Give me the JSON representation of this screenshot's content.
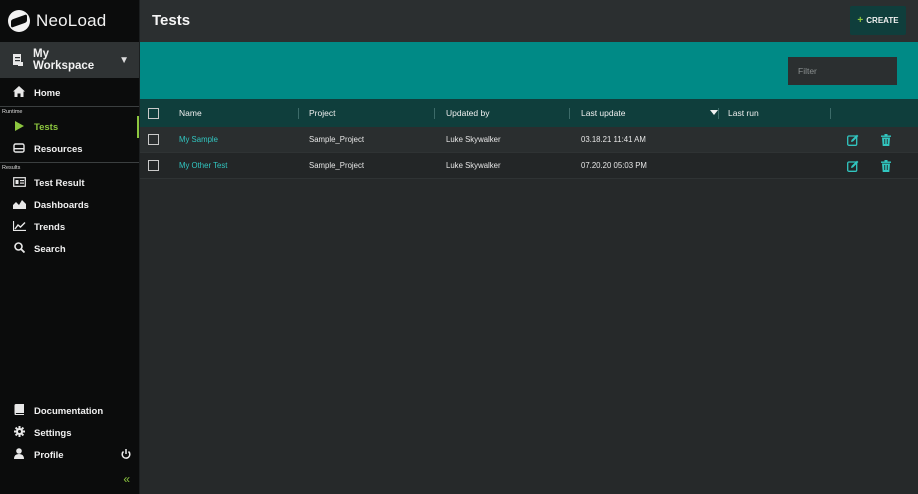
{
  "app": {
    "name": "NeoLoad"
  },
  "sidebar": {
    "workspace_label": "My Workspace",
    "home_label": "Home",
    "section_runtime": "Runtime",
    "runtime_items": [
      {
        "label": "Tests",
        "icon": "play-icon"
      },
      {
        "label": "Resources",
        "icon": "resources-icon"
      }
    ],
    "section_results": "Results",
    "results_items": [
      {
        "label": "Test Result",
        "icon": "test-result-icon"
      },
      {
        "label": "Dashboards",
        "icon": "dashboards-icon"
      },
      {
        "label": "Trends",
        "icon": "trends-icon"
      },
      {
        "label": "Search",
        "icon": "search-icon"
      }
    ],
    "bottom_items": [
      {
        "label": "Documentation",
        "icon": "book-icon"
      },
      {
        "label": "Settings",
        "icon": "gear-icon"
      },
      {
        "label": "Profile",
        "icon": "user-icon"
      }
    ],
    "active_item": "Tests"
  },
  "header": {
    "title": "Tests",
    "create_label": "CREATE"
  },
  "filter": {
    "placeholder": "Filter",
    "value": ""
  },
  "table": {
    "columns": [
      "Name",
      "Project",
      "Updated by",
      "Last update",
      "Last run"
    ],
    "sorted_column": "Last update",
    "rows": [
      {
        "name": "My Sample",
        "project": "Sample_Project",
        "updated_by": "Luke Skywalker",
        "last_update": "03.18.21 11:41 AM",
        "last_run": ""
      },
      {
        "name": "My Other Test",
        "project": "Sample_Project",
        "updated_by": "Luke Skywalker",
        "last_update": "07.20.20 05:03 PM",
        "last_run": ""
      }
    ]
  },
  "colors": {
    "accent": "#8cc63f",
    "teal": "#008a86",
    "header_teal": "#0f3e3c",
    "link": "#31c6c0"
  }
}
